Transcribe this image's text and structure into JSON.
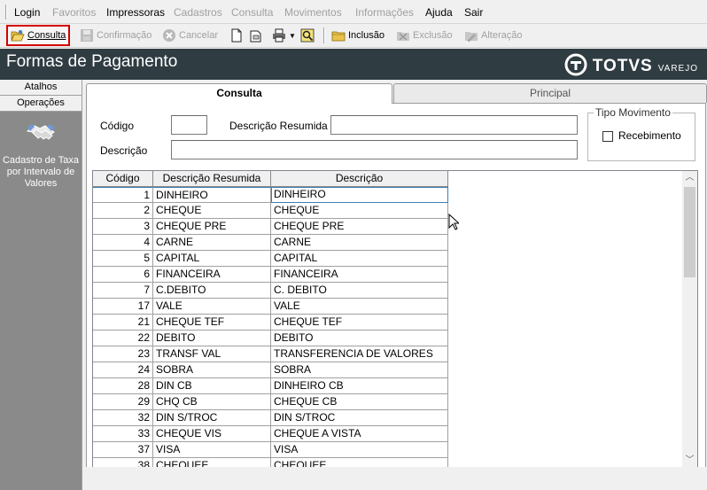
{
  "menu": [
    "Login",
    "Favoritos",
    "Impressoras",
    "Cadastros",
    "Consulta",
    "Movimentos",
    "Informações",
    "Ajuda",
    "Sair"
  ],
  "menu_enabled": [
    true,
    false,
    true,
    false,
    false,
    false,
    false,
    true,
    true
  ],
  "toolbar": {
    "consulta": "Consulta",
    "confirmacao": "Confirmação",
    "cancelar": "Cancelar",
    "inclusao": "Inclusão",
    "exclusao": "Exclusão",
    "alteracao": "Alteração"
  },
  "window": {
    "title": "Formas de Pagamento",
    "brand": "TOTVS",
    "brand_sub": "VAREJO"
  },
  "sidebar": {
    "tabs": [
      "Atalhos",
      "Operações"
    ],
    "item_label": "Cadastro de Taxa por Intervalo de Valores"
  },
  "tabs": {
    "active": "Consulta",
    "inactive": "Principal"
  },
  "form": {
    "codigo_label": "Código",
    "codigo_value": "",
    "descricao_resumida_label": "Descrição Resumida",
    "descricao_resumida_value": "",
    "descricao_label": "Descrição",
    "descricao_value": "",
    "tipo_movimento_label": "Tipo Movimento",
    "recebimento_label": "Recebimento",
    "recebimento_checked": false
  },
  "table": {
    "columns": [
      "Código",
      "Descrição Resumida",
      "Descrição"
    ],
    "rows": [
      [
        "1",
        "DINHEIRO",
        "DINHEIRO"
      ],
      [
        "2",
        "CHEQUE",
        "CHEQUE"
      ],
      [
        "3",
        "CHEQUE PRE",
        "CHEQUE PRE"
      ],
      [
        "4",
        "CARNE",
        "CARNE"
      ],
      [
        "5",
        "CAPITAL",
        "CAPITAL"
      ],
      [
        "6",
        "FINANCEIRA",
        "FINANCEIRA"
      ],
      [
        "7",
        "C.DEBITO",
        "C. DEBITO"
      ],
      [
        "17",
        "VALE",
        "VALE"
      ],
      [
        "21",
        "CHEQUE TEF",
        "CHEQUE TEF"
      ],
      [
        "22",
        "DEBITO",
        "DEBITO"
      ],
      [
        "23",
        "TRANSF VAL",
        "TRANSFERENCIA DE VALORES"
      ],
      [
        "24",
        "SOBRA",
        "SOBRA"
      ],
      [
        "28",
        "DIN CB",
        "DINHEIRO CB"
      ],
      [
        "29",
        "CHQ CB",
        "CHEQUE CB"
      ],
      [
        "32",
        "DIN S/TROC",
        "DIN S/TROC"
      ],
      [
        "33",
        "CHEQUE VIS",
        "CHEQUE A VISTA"
      ],
      [
        "37",
        "VISA",
        "VISA"
      ],
      [
        "38",
        "CHEQUEE",
        "CHEQUEE"
      ]
    ]
  },
  "colors": {
    "titlebar": "#2f3c42",
    "sidebar": "#8a8a8a",
    "highlight": "#d40000"
  }
}
